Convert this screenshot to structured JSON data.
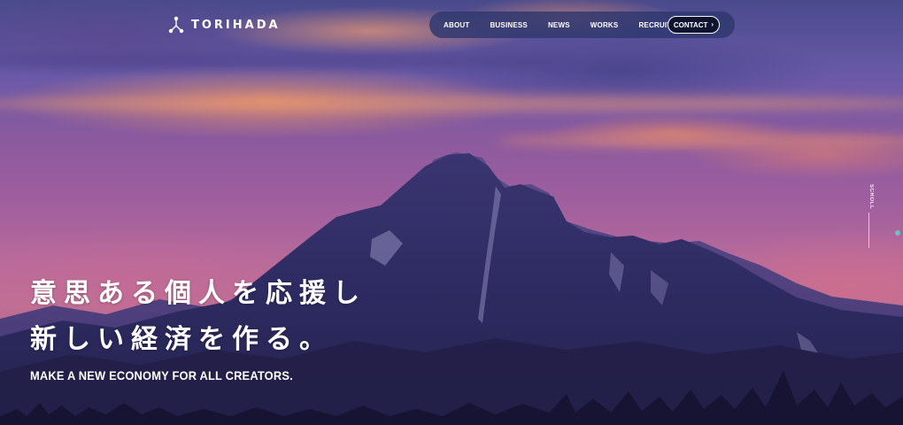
{
  "brand": {
    "name": "TORIHADA",
    "logo_icon": "node-network-icon"
  },
  "nav": {
    "items": [
      {
        "label": "ABOUT"
      },
      {
        "label": "BUSINESS"
      },
      {
        "label": "NEWS"
      },
      {
        "label": "WORKS"
      },
      {
        "label": "RECRUIT"
      }
    ],
    "contact": {
      "label": "CONTACT",
      "icon": "chevron-right-icon"
    }
  },
  "hero": {
    "headline_line1": "意思ある個人を応援し",
    "headline_line2": "新しい経済を作る。",
    "subheadline": "MAKE A NEW ECONOMY FOR ALL CREATORS.",
    "scroll_label": "SCROLL"
  },
  "colors": {
    "nav_background": "#2d376e",
    "contact_background": "#0f1530",
    "accent_dot": "#6ec1c6",
    "text": "#ffffff"
  }
}
